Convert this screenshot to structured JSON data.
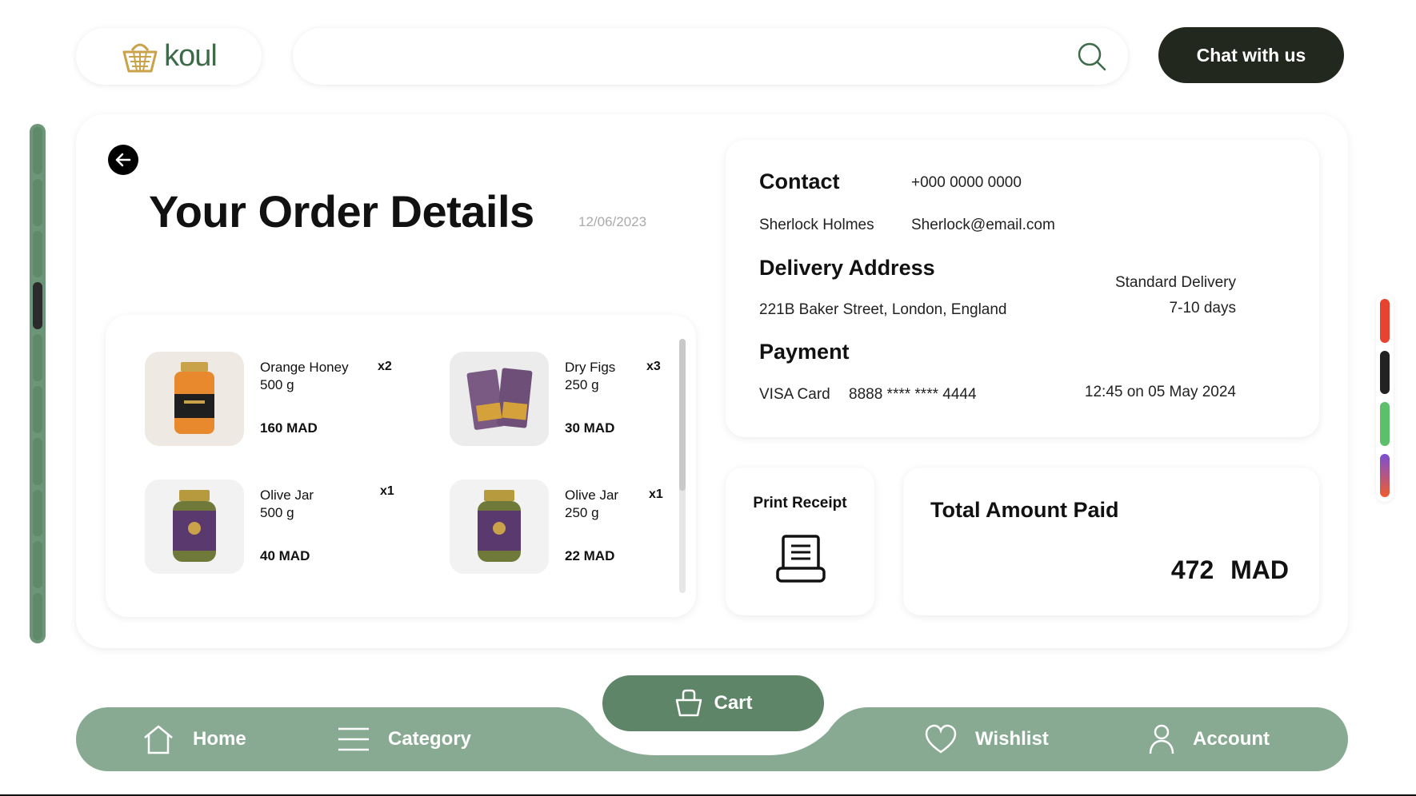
{
  "header": {
    "logo_text": "koul",
    "search_placeholder": "",
    "chat_label": "Chat with us"
  },
  "order": {
    "title": "Your Order Details",
    "date": "12/06/2023",
    "items": [
      {
        "name": "Orange Honey",
        "weight": "500 g",
        "price": "160 MAD",
        "qty": "x2"
      },
      {
        "name": "Dry Figs",
        "weight": "250 g",
        "price": "30 MAD",
        "qty": "x3"
      },
      {
        "name": "Olive Jar",
        "weight": "500 g",
        "price": "40 MAD",
        "qty": "x1"
      },
      {
        "name": "Olive Jar",
        "weight": "250 g",
        "price": "22 MAD",
        "qty": "x1"
      }
    ]
  },
  "contact": {
    "heading": "Contact",
    "phone": "+000 0000 0000",
    "name": "Sherlock Holmes",
    "email": "Sherlock@email.com"
  },
  "delivery": {
    "heading": "Delivery Address",
    "address": "221B Baker Street, London, England",
    "method": "Standard Delivery",
    "duration": "7-10 days"
  },
  "payment": {
    "heading": "Payment",
    "card_type": "VISA Card",
    "card_number": "8888 **** **** 4444",
    "time": "12:45 on 05 May 2024"
  },
  "receipt": {
    "label": "Print Receipt"
  },
  "total": {
    "label": "Total Amount Paid",
    "amount": "472 MAD"
  },
  "nav": {
    "home": "Home",
    "category": "Category",
    "cart": "Cart",
    "wishlist": "Wishlist",
    "account": "Account"
  },
  "colors": {
    "accent": "#88aa92",
    "accent_dark": "#5e8567",
    "chat_bg": "#23281f",
    "swatches": [
      "#e8432f",
      "#222222",
      "#5cc06b",
      "#7a4fd6"
    ]
  }
}
